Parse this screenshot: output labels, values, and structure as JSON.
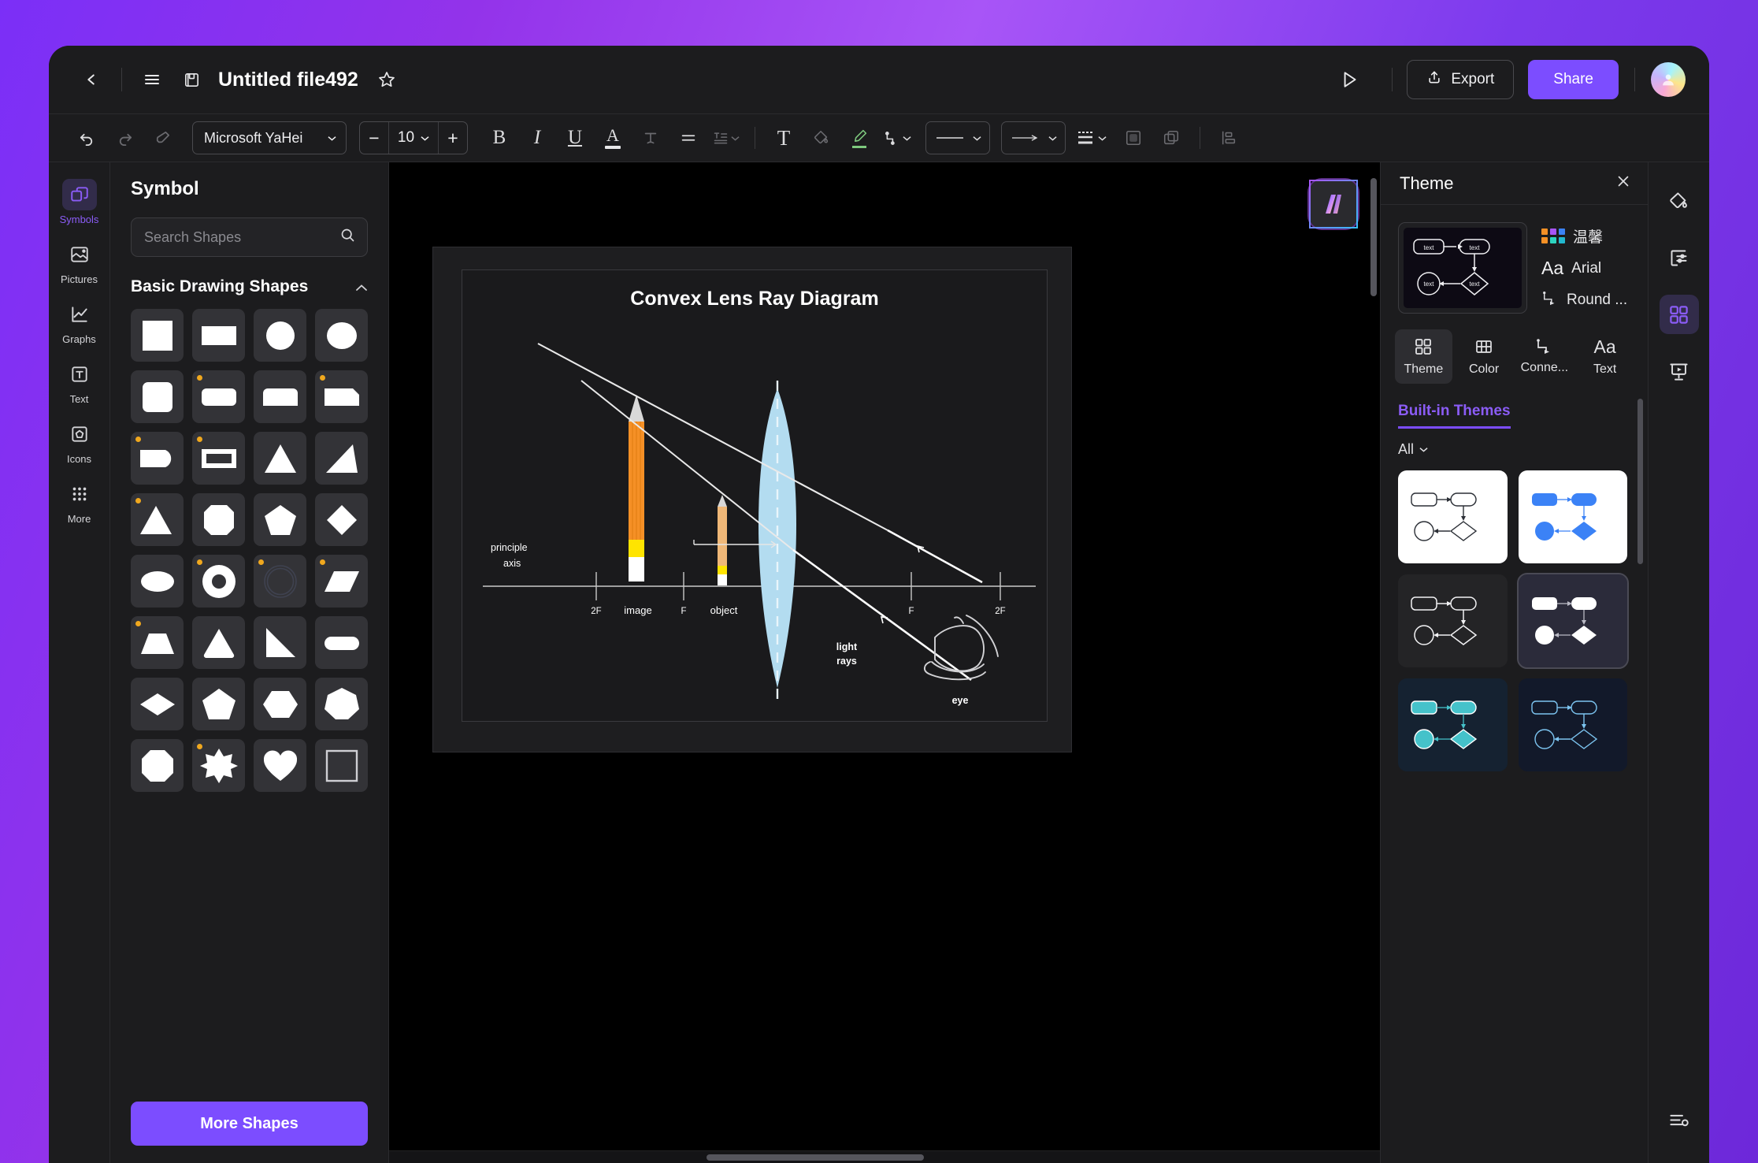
{
  "titlebar": {
    "back_icon": "chevron-left-icon",
    "menu_icon": "hamburger-menu-icon",
    "save_icon": "save-disk-icon",
    "doc_title": "Untitled file492",
    "favorite_icon": "star-icon",
    "play_icon": "play-icon",
    "export_label": "Export",
    "share_label": "Share"
  },
  "toolbar": {
    "font_family": "Microsoft YaHei",
    "font_size": "10",
    "decrease_label": "−",
    "increase_label": "+",
    "bold_label": "B",
    "italic_label": "I",
    "underline_label": "U",
    "font_color_label": "A",
    "text_effect_label": "T",
    "textbox_label": "T"
  },
  "sidebar": {
    "items": [
      {
        "label": "Symbols",
        "icon": "symbols-icon",
        "active": true
      },
      {
        "label": "Pictures",
        "icon": "pictures-icon",
        "active": false
      },
      {
        "label": "Graphs",
        "icon": "graphs-icon",
        "active": false
      },
      {
        "label": "Text",
        "icon": "text-icon",
        "active": false
      },
      {
        "label": "Icons",
        "icon": "icons-icon",
        "active": false
      },
      {
        "label": "More",
        "icon": "more-dots-icon",
        "active": false
      }
    ]
  },
  "symbol_panel": {
    "title": "Symbol",
    "search_placeholder": "Search Shapes",
    "search_value": "",
    "section_title": "Basic Drawing Shapes",
    "collapse_icon": "chevron-up-icon",
    "more_shapes_label": "More Shapes",
    "shapes": [
      {
        "name": "square",
        "badge": false
      },
      {
        "name": "rectangle",
        "badge": false
      },
      {
        "name": "circle",
        "badge": false
      },
      {
        "name": "ellipse-circle",
        "badge": false
      },
      {
        "name": "rounded-square",
        "badge": false
      },
      {
        "name": "rounded-rectangle",
        "badge": true
      },
      {
        "name": "top-rounded-rectangle",
        "badge": false
      },
      {
        "name": "corner-cut-rectangle",
        "badge": true
      },
      {
        "name": "single-round-corner-rect",
        "badge": true
      },
      {
        "name": "frame-rectangle",
        "badge": true
      },
      {
        "name": "triangle",
        "badge": false
      },
      {
        "name": "right-triangle",
        "badge": false
      },
      {
        "name": "triangle-narrow",
        "badge": true
      },
      {
        "name": "octagon-square",
        "badge": false
      },
      {
        "name": "pentagon",
        "badge": false
      },
      {
        "name": "diamond",
        "badge": false
      },
      {
        "name": "ellipse",
        "badge": false
      },
      {
        "name": "donut",
        "badge": true
      },
      {
        "name": "concentric-circles",
        "badge": true
      },
      {
        "name": "parallelogram",
        "badge": true
      },
      {
        "name": "trapezoid",
        "badge": true
      },
      {
        "name": "rounded-triangle",
        "badge": false
      },
      {
        "name": "right-triangle-flipped",
        "badge": false
      },
      {
        "name": "stadium",
        "badge": false
      },
      {
        "name": "flat-diamond",
        "badge": false
      },
      {
        "name": "pentagon-wide",
        "badge": false
      },
      {
        "name": "hexagon",
        "badge": false
      },
      {
        "name": "heptagon",
        "badge": false
      },
      {
        "name": "octagon",
        "badge": false
      },
      {
        "name": "eight-point-star",
        "badge": true
      },
      {
        "name": "heart",
        "badge": false
      },
      {
        "name": "square-outline",
        "badge": false
      }
    ]
  },
  "canvas": {
    "ai_badge_icon": "ai-assistant-icon",
    "diagram": {
      "title": "Convex Lens Ray Diagram",
      "labels": {
        "principle_axis_line1": "principle",
        "principle_axis_line2": "axis",
        "far_left_tick": "2F",
        "image": "image",
        "left_focus": "F",
        "object": "object",
        "right_focus": "F",
        "far_right_tick": "2F",
        "light_rays_line1": "light",
        "light_rays_line2": "rays",
        "eye": "eye"
      },
      "colors": {
        "lens": "#b3dcf0",
        "pencil_body": "#f59026",
        "pencil_body_small": "#f0b878",
        "pencil_band": "#ffe400",
        "pencil_wood": "#d8d8d8",
        "ray": "#ffffff",
        "axis": "#c9c9c9",
        "page_bg": "#1a1a1c"
      }
    }
  },
  "theme_panel": {
    "header_title": "Theme",
    "close_icon": "close-icon",
    "preview_node_label": "text",
    "color_scheme": "温馨",
    "font_name": "Arial",
    "connector_name": "Round ...",
    "font_prefix": "Aa",
    "tabs": [
      {
        "label": "Theme",
        "icon": "theme-grid-icon",
        "active": true
      },
      {
        "label": "Color",
        "icon": "color-table-icon",
        "active": false
      },
      {
        "label": "Conne...",
        "icon": "connector-icon",
        "active": false
      },
      {
        "label": "Text",
        "icon": "text-aa-icon",
        "active": false
      }
    ],
    "builtin_label": "Built-in Themes",
    "filter_label": "All",
    "filter_icon": "chevron-down-icon",
    "themes": [
      {
        "name": "light-outline",
        "bg": "#ffffff",
        "stroke": "#2b2f36",
        "fill": "none",
        "selected": false
      },
      {
        "name": "light-blue-fill",
        "bg": "#ffffff",
        "stroke": "#3b82f6",
        "fill": "#3b82f6",
        "selected": false
      },
      {
        "name": "dark-outline",
        "bg": "#242426",
        "stroke": "#f2f2f4",
        "fill": "none",
        "selected": false
      },
      {
        "name": "dark-white-fill",
        "bg": "#2b2b3a",
        "stroke": "#ffffff",
        "fill": "#ffffff",
        "selected": true
      },
      {
        "name": "navy-teal-fill",
        "bg": "#152231",
        "stroke": "#ffffff",
        "fill": "#45c2ca",
        "selected": false
      },
      {
        "name": "navy-blue-line",
        "bg": "#12192a",
        "stroke": "#7cc4f0",
        "fill": "none",
        "selected": false
      }
    ]
  },
  "right_rail": {
    "items": [
      {
        "name": "fill-bucket-icon",
        "active": false
      },
      {
        "name": "page-settings-icon",
        "active": false
      },
      {
        "name": "theme-grid-icon",
        "active": true
      },
      {
        "name": "presentation-icon",
        "active": false
      }
    ],
    "bottom_item": {
      "name": "list-settings-icon",
      "active": false
    }
  }
}
